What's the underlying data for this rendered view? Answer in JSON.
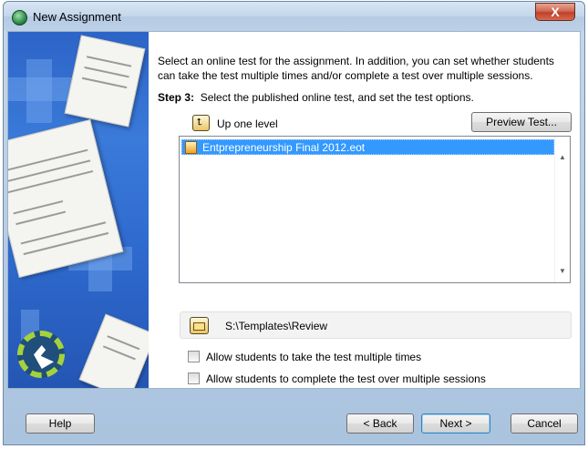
{
  "window": {
    "title": "New Assignment",
    "close_glyph": "X"
  },
  "intro": "Select an online test for the assignment.  In addition, you can set whether students can take the test multiple times and/or complete a test over multiple sessions.",
  "step": {
    "label": "Step 3:",
    "text": "Select the published online test, and set the test options."
  },
  "toolbar": {
    "up_label": "Up one level",
    "preview_label": "Preview Test..."
  },
  "file_list": {
    "items": [
      {
        "name": "Entprepreneurship Final 2012.eot",
        "selected": true,
        "icon": "test-file-icon"
      }
    ]
  },
  "path": {
    "value": "S:\\Templates\\Review",
    "icon": "folder-icon"
  },
  "options": [
    {
      "label": "Allow students to take the test multiple times",
      "checked": false
    },
    {
      "label": "Allow students to complete the test over multiple sessions",
      "checked": false
    }
  ],
  "buttons": {
    "help": "Help",
    "back": "< Back",
    "next": "Next >",
    "cancel": "Cancel"
  },
  "colors": {
    "selection": "#3399ff",
    "side_panel": "#2f6bcf",
    "close_button": "#c0402a"
  }
}
